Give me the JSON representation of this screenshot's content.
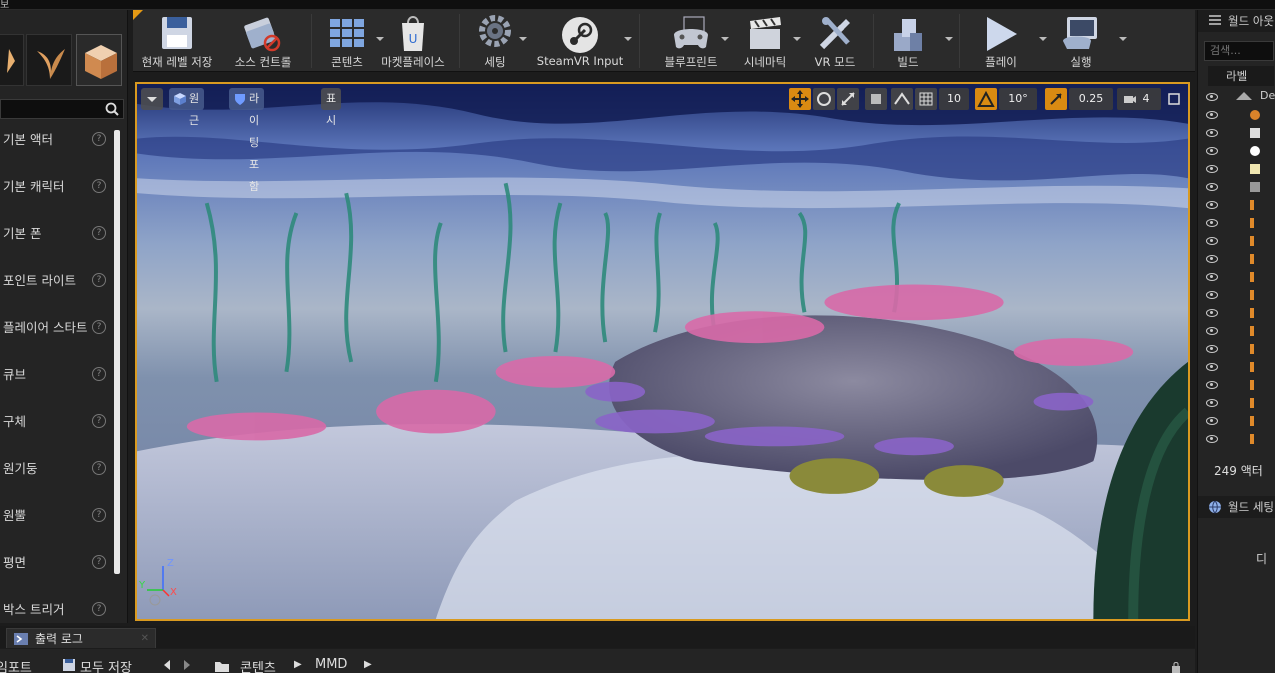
{
  "menu": {
    "label": "보"
  },
  "toolbar": {
    "items": [
      {
        "label": "현재 레벨 저장",
        "icon": "save-icon"
      },
      {
        "label": "소스 컨트롤",
        "icon": "source-control-icon"
      },
      {
        "label": "콘텐츠",
        "icon": "content-icon"
      },
      {
        "label": "마켓플레이스",
        "icon": "marketplace-icon"
      },
      {
        "label": "세팅",
        "icon": "settings-gear-icon"
      },
      {
        "label": "SteamVR Input",
        "icon": "steam-icon"
      },
      {
        "label": "블루프린트",
        "icon": "gamepad-icon"
      },
      {
        "label": "시네마틱",
        "icon": "clapper-icon"
      },
      {
        "label": "VR 모드",
        "icon": "vr-tools-icon"
      },
      {
        "label": "빌드",
        "icon": "build-blocks-icon"
      },
      {
        "label": "플레이",
        "icon": "play-icon"
      },
      {
        "label": "실행",
        "icon": "launch-monitor-icon"
      }
    ]
  },
  "place_panel": {
    "items": [
      {
        "label": "기본 액터"
      },
      {
        "label": "기본 캐릭터"
      },
      {
        "label": "기본 폰"
      },
      {
        "label": "포인트 라이트"
      },
      {
        "label": "플레이어 스타트"
      },
      {
        "label": "큐브"
      },
      {
        "label": "구체"
      },
      {
        "label": "원기둥"
      },
      {
        "label": "원뿔"
      },
      {
        "label": "평면"
      },
      {
        "label": "박스 트리거"
      }
    ]
  },
  "viewport": {
    "perspective_label": "원근",
    "lighting_label": "라이팅포함",
    "show_label": "표시",
    "grid_snap_value": "10",
    "rotation_snap_value": "10°",
    "scale_snap_value": "0.25",
    "camera_speed_value": "4",
    "axis": {
      "z": "Z",
      "x": "X",
      "y": "Y"
    }
  },
  "bottom": {
    "output_log_tab": "출력 로그",
    "import_label": "임포트",
    "save_all_label": "모두 저장",
    "path_root": "콘텐츠",
    "path_folder": "MMD"
  },
  "outliner": {
    "title": "월드 아웃",
    "search_placeholder": "검색...",
    "label_column": "라벨",
    "first_row_label": "De",
    "actor_count": "249 액터",
    "world_settings_title": "월드 세팅",
    "world_settings_text": "디"
  },
  "colors": {
    "accent": "#d99a20",
    "panel": "#242424",
    "toolbar": "#2b2b2b"
  }
}
